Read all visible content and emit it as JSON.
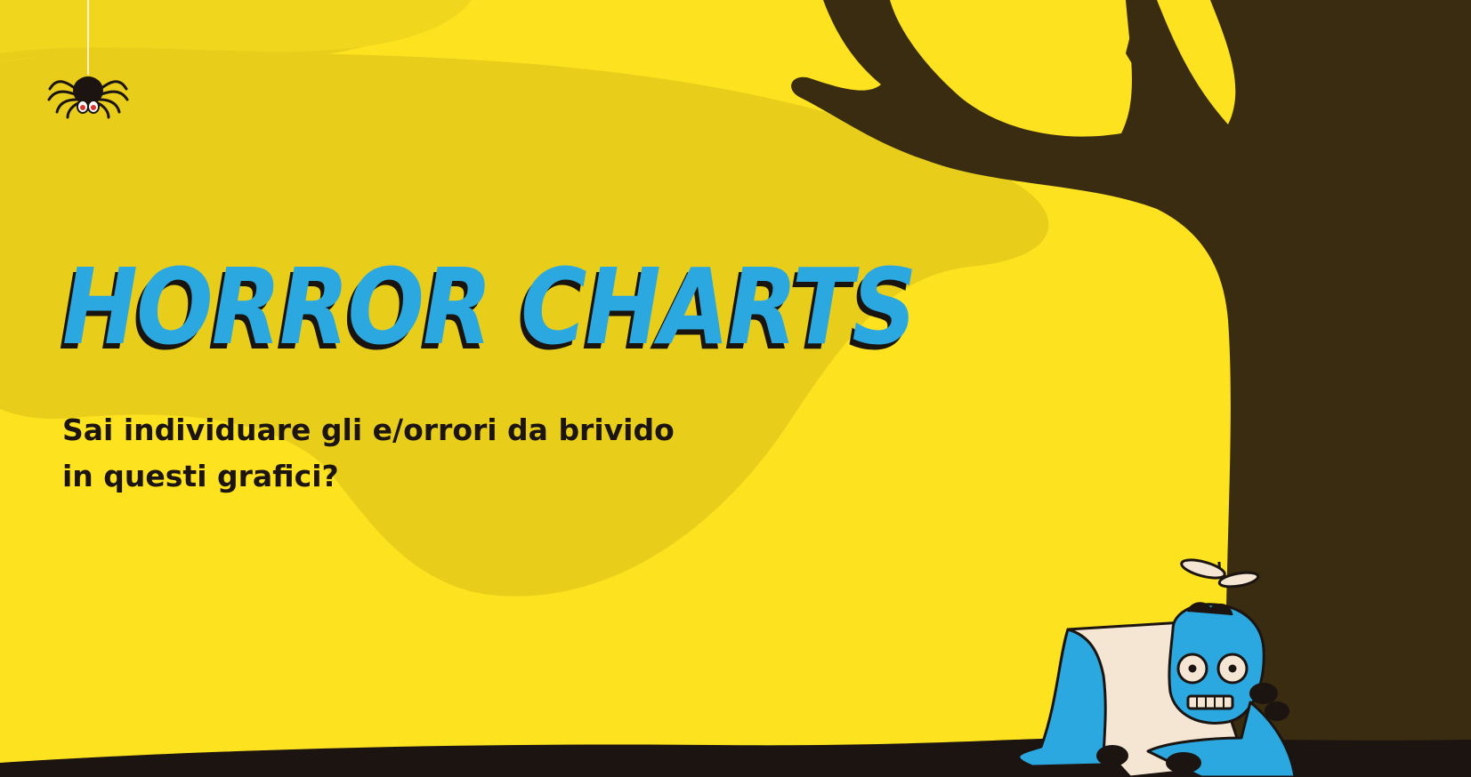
{
  "hero": {
    "title": "HORROR CHARTS",
    "subtitle_line1": "Sai individuare gli e/orrori da brivido",
    "subtitle_line2": "in questi grafici?"
  },
  "icons": {
    "spider": "spider-icon",
    "tree": "tree-silhouette",
    "zombie": "zombie-illustration",
    "pumpkin": "jack-o-lantern-icon"
  },
  "colors": {
    "background": "#fde21f",
    "blob": "#e6cc1b",
    "title": "#2ba8e0",
    "tree": "#3a2c10",
    "ground": "#1b1410",
    "text": "#1b1410"
  }
}
